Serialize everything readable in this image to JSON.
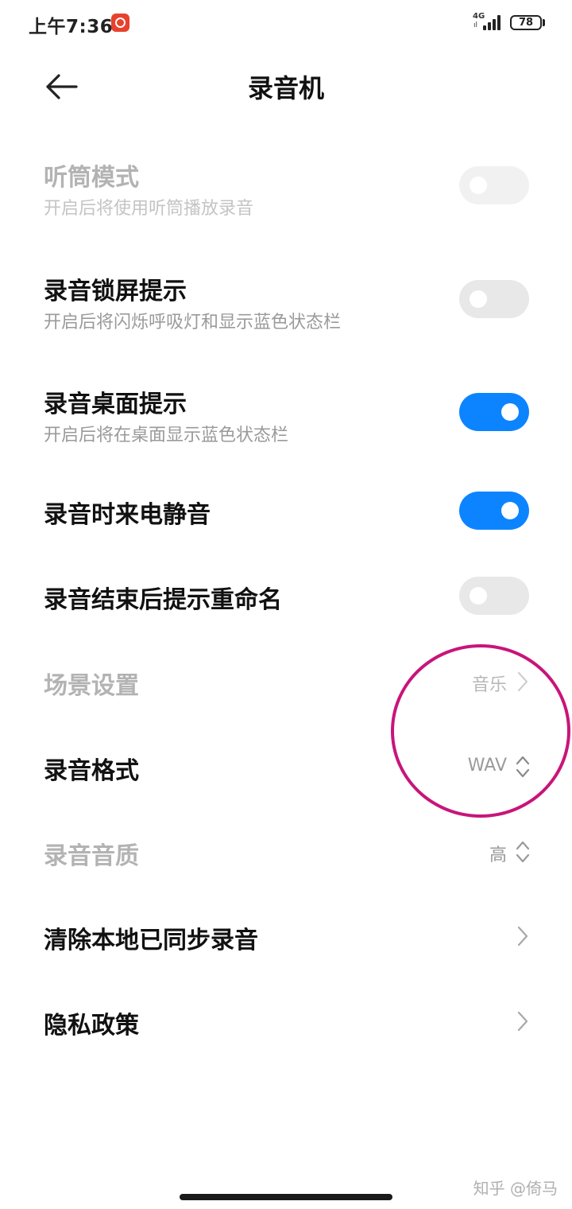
{
  "status_bar": {
    "time": "上午7:36",
    "network": "4G",
    "network_sub": "ıl",
    "battery": "78",
    "app_badge_icon": "netease-music-icon",
    "badge_color": "#e8412d"
  },
  "header": {
    "title": "录音机",
    "back_icon": "arrow-left-icon"
  },
  "settings": {
    "earpiece_mode": {
      "title": "听筒模式",
      "subtitle": "开启后将使用听筒播放录音",
      "enabled": false,
      "disabled": true
    },
    "lock_screen_hint": {
      "title": "录音锁屏提示",
      "subtitle": "开启后将闪烁呼吸灯和显示蓝色状态栏",
      "enabled": false
    },
    "desktop_hint": {
      "title": "录音桌面提示",
      "subtitle": "开启后将在桌面显示蓝色状态栏",
      "enabled": true
    },
    "mute_calls": {
      "title": "录音时来电静音",
      "enabled": true
    },
    "rename_prompt": {
      "title": "录音结束后提示重命名",
      "enabled": false
    },
    "scene": {
      "title": "场景设置",
      "value": "音乐",
      "disabled": true
    },
    "format": {
      "title": "录音格式",
      "value": "WAV"
    },
    "quality": {
      "title": "录音音质",
      "value": "高",
      "disabled": true
    },
    "clear_synced": {
      "title": "清除本地已同步录音"
    },
    "privacy": {
      "title": "隐私政策"
    }
  },
  "colors": {
    "toggle_on": "#0d84ff",
    "toggle_off": "#e8e8e8",
    "annotation": "#c8157a"
  },
  "watermark": "知乎 @倚马"
}
